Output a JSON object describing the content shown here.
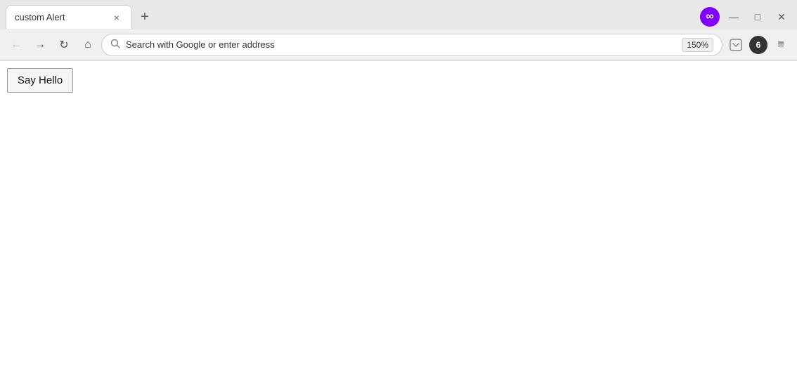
{
  "browser": {
    "tab": {
      "title": "custom Alert",
      "close_label": "×"
    },
    "new_tab_label": "+",
    "logo": {
      "symbol": "∞",
      "color": "#8000ff"
    },
    "window_controls": {
      "minimize": "—",
      "maximize": "□",
      "close": "✕"
    }
  },
  "toolbar": {
    "back_label": "←",
    "forward_label": "→",
    "reload_label": "↻",
    "home_label": "⌂",
    "search_placeholder": "Search with Google or enter address",
    "zoom": "150%",
    "menu_label": "≡"
  },
  "page": {
    "button_label": "Say Hello"
  }
}
